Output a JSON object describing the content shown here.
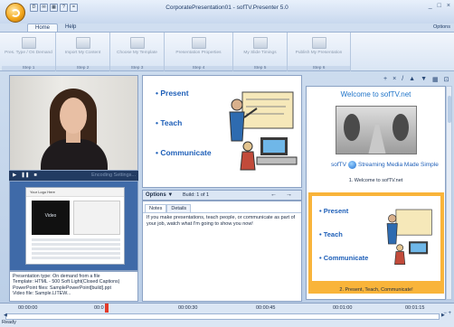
{
  "window": {
    "title": "CorporatePresentation01 - sofTV.Presenter 5.0",
    "options": "Options",
    "controls": [
      "_",
      "□",
      "×"
    ]
  },
  "quick_access": [
    "D",
    "✉",
    "▦",
    "?",
    "="
  ],
  "tabs": [
    {
      "label": "Home",
      "active": true
    },
    {
      "label": "Help",
      "active": false
    }
  ],
  "ribbon": [
    {
      "label": "Pres. Type / On Demand",
      "step": "Step 1"
    },
    {
      "label": "Import My Content",
      "step": "Step 2"
    },
    {
      "label": "Choose My Template",
      "step": "Step 3"
    },
    {
      "label": "Presentation Properties",
      "step": "Step 4"
    },
    {
      "label": "My Slide Timings",
      "step": "Step 5"
    },
    {
      "label": "Publish My Presentation",
      "step": "Step 6"
    }
  ],
  "player": {
    "encoding": "Encoding Settings..."
  },
  "template_preview": {
    "header_left": "Your Logo Here",
    "video": "Video"
  },
  "info": [
    "Presentation type: On demand from a file",
    "Template: HTML - 500 Soft Light(Closed Captions)",
    "PowerPoint files: SamplePowerPoint[build].ppt",
    "Video file: Sample.LITEW..."
  ],
  "slide": {
    "bullets": [
      "Present",
      "Teach",
      "Communicate"
    ]
  },
  "options_bar": {
    "label": "Options ▼",
    "build": "Build: 1 of 1",
    "arrows": "← →"
  },
  "notes": {
    "tabs": [
      {
        "label": "Notes",
        "active": true
      },
      {
        "label": "Details",
        "active": false
      }
    ],
    "text": "If you make presentations, teach people, or communicate as part of your job, watch what I'm going to show you now!"
  },
  "slide_tools": [
    "+",
    "×",
    "/",
    "▲",
    "▼",
    "▦",
    "⊡"
  ],
  "slides": [
    {
      "title": "Welcome to sofTV.net",
      "logo": "sofTV",
      "logo_tag": "Streaming Media Made Simple",
      "caption": "1. Welcome to sofTV.net"
    },
    {
      "caption": "2. Present, Teach, Communicate!",
      "selected": true
    }
  ],
  "timeline": {
    "ticks": [
      "00:00:00",
      "00:0",
      "00:00:30",
      "00:00:45",
      "00:01:00",
      "00:01:15"
    ]
  },
  "status": {
    "text": "Ready",
    "zoom": "− +"
  }
}
